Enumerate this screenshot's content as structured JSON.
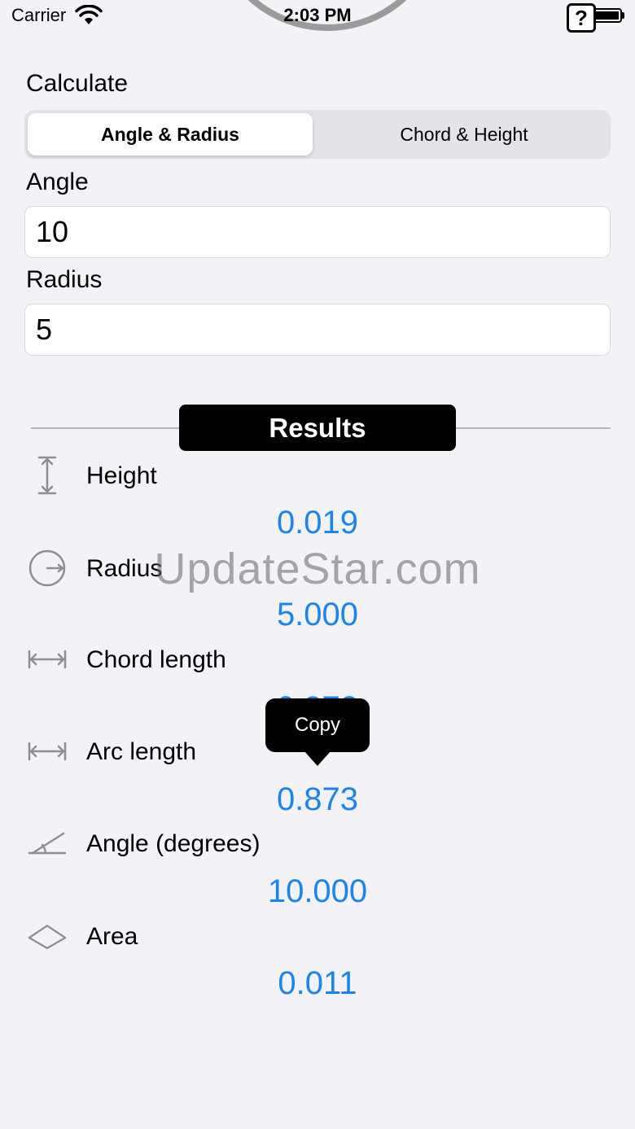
{
  "status_bar": {
    "carrier": "Carrier",
    "time": "2:03 PM"
  },
  "help_button": {
    "label": "?"
  },
  "calculate": {
    "label": "Calculate",
    "options": [
      "Angle & Radius",
      "Chord & Height"
    ],
    "selected": "Angle & Radius"
  },
  "inputs": {
    "angle": {
      "label": "Angle",
      "value": "10"
    },
    "radius": {
      "label": "Radius",
      "value": "5"
    }
  },
  "results_header": "Results",
  "results": [
    {
      "label": "Height",
      "value": "0.019",
      "icon": "height-icon"
    },
    {
      "label": "Radius",
      "value": "5.000",
      "icon": "radius-icon"
    },
    {
      "label": "Chord length",
      "value": "0.872",
      "icon": "chord-length-icon"
    },
    {
      "label": "Arc length",
      "value": "0.873",
      "icon": "arc-length-icon"
    },
    {
      "label": "Angle (degrees)",
      "value": "10.000",
      "icon": "angle-icon"
    },
    {
      "label": "Area",
      "value": "0.011",
      "icon": "area-icon"
    }
  ],
  "context_menu": {
    "copy_label": "Copy"
  },
  "watermark": "UpdateStar.com",
  "colors": {
    "accent": "#1a84f0",
    "background": "#f2f2f7",
    "header": "#000000"
  }
}
